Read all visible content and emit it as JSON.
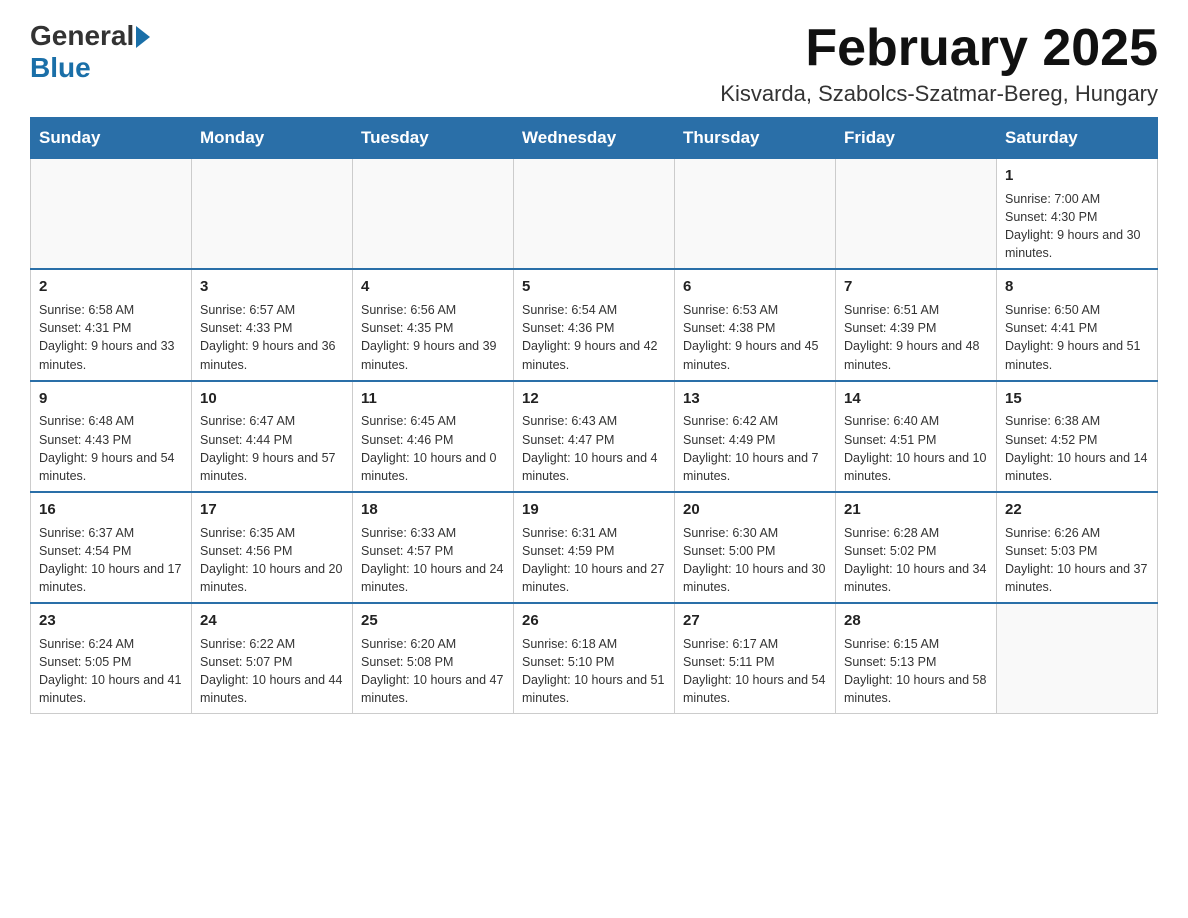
{
  "header": {
    "logo_general": "General",
    "logo_blue": "Blue",
    "month_title": "February 2025",
    "location": "Kisvarda, Szabolcs-Szatmar-Bereg, Hungary"
  },
  "days_of_week": [
    "Sunday",
    "Monday",
    "Tuesday",
    "Wednesday",
    "Thursday",
    "Friday",
    "Saturday"
  ],
  "weeks": [
    {
      "cells": [
        {
          "day": "",
          "info": ""
        },
        {
          "day": "",
          "info": ""
        },
        {
          "day": "",
          "info": ""
        },
        {
          "day": "",
          "info": ""
        },
        {
          "day": "",
          "info": ""
        },
        {
          "day": "",
          "info": ""
        },
        {
          "day": "1",
          "info": "Sunrise: 7:00 AM\nSunset: 4:30 PM\nDaylight: 9 hours and 30 minutes."
        }
      ]
    },
    {
      "cells": [
        {
          "day": "2",
          "info": "Sunrise: 6:58 AM\nSunset: 4:31 PM\nDaylight: 9 hours and 33 minutes."
        },
        {
          "day": "3",
          "info": "Sunrise: 6:57 AM\nSunset: 4:33 PM\nDaylight: 9 hours and 36 minutes."
        },
        {
          "day": "4",
          "info": "Sunrise: 6:56 AM\nSunset: 4:35 PM\nDaylight: 9 hours and 39 minutes."
        },
        {
          "day": "5",
          "info": "Sunrise: 6:54 AM\nSunset: 4:36 PM\nDaylight: 9 hours and 42 minutes."
        },
        {
          "day": "6",
          "info": "Sunrise: 6:53 AM\nSunset: 4:38 PM\nDaylight: 9 hours and 45 minutes."
        },
        {
          "day": "7",
          "info": "Sunrise: 6:51 AM\nSunset: 4:39 PM\nDaylight: 9 hours and 48 minutes."
        },
        {
          "day": "8",
          "info": "Sunrise: 6:50 AM\nSunset: 4:41 PM\nDaylight: 9 hours and 51 minutes."
        }
      ]
    },
    {
      "cells": [
        {
          "day": "9",
          "info": "Sunrise: 6:48 AM\nSunset: 4:43 PM\nDaylight: 9 hours and 54 minutes."
        },
        {
          "day": "10",
          "info": "Sunrise: 6:47 AM\nSunset: 4:44 PM\nDaylight: 9 hours and 57 minutes."
        },
        {
          "day": "11",
          "info": "Sunrise: 6:45 AM\nSunset: 4:46 PM\nDaylight: 10 hours and 0 minutes."
        },
        {
          "day": "12",
          "info": "Sunrise: 6:43 AM\nSunset: 4:47 PM\nDaylight: 10 hours and 4 minutes."
        },
        {
          "day": "13",
          "info": "Sunrise: 6:42 AM\nSunset: 4:49 PM\nDaylight: 10 hours and 7 minutes."
        },
        {
          "day": "14",
          "info": "Sunrise: 6:40 AM\nSunset: 4:51 PM\nDaylight: 10 hours and 10 minutes."
        },
        {
          "day": "15",
          "info": "Sunrise: 6:38 AM\nSunset: 4:52 PM\nDaylight: 10 hours and 14 minutes."
        }
      ]
    },
    {
      "cells": [
        {
          "day": "16",
          "info": "Sunrise: 6:37 AM\nSunset: 4:54 PM\nDaylight: 10 hours and 17 minutes."
        },
        {
          "day": "17",
          "info": "Sunrise: 6:35 AM\nSunset: 4:56 PM\nDaylight: 10 hours and 20 minutes."
        },
        {
          "day": "18",
          "info": "Sunrise: 6:33 AM\nSunset: 4:57 PM\nDaylight: 10 hours and 24 minutes."
        },
        {
          "day": "19",
          "info": "Sunrise: 6:31 AM\nSunset: 4:59 PM\nDaylight: 10 hours and 27 minutes."
        },
        {
          "day": "20",
          "info": "Sunrise: 6:30 AM\nSunset: 5:00 PM\nDaylight: 10 hours and 30 minutes."
        },
        {
          "day": "21",
          "info": "Sunrise: 6:28 AM\nSunset: 5:02 PM\nDaylight: 10 hours and 34 minutes."
        },
        {
          "day": "22",
          "info": "Sunrise: 6:26 AM\nSunset: 5:03 PM\nDaylight: 10 hours and 37 minutes."
        }
      ]
    },
    {
      "cells": [
        {
          "day": "23",
          "info": "Sunrise: 6:24 AM\nSunset: 5:05 PM\nDaylight: 10 hours and 41 minutes."
        },
        {
          "day": "24",
          "info": "Sunrise: 6:22 AM\nSunset: 5:07 PM\nDaylight: 10 hours and 44 minutes."
        },
        {
          "day": "25",
          "info": "Sunrise: 6:20 AM\nSunset: 5:08 PM\nDaylight: 10 hours and 47 minutes."
        },
        {
          "day": "26",
          "info": "Sunrise: 6:18 AM\nSunset: 5:10 PM\nDaylight: 10 hours and 51 minutes."
        },
        {
          "day": "27",
          "info": "Sunrise: 6:17 AM\nSunset: 5:11 PM\nDaylight: 10 hours and 54 minutes."
        },
        {
          "day": "28",
          "info": "Sunrise: 6:15 AM\nSunset: 5:13 PM\nDaylight: 10 hours and 58 minutes."
        },
        {
          "day": "",
          "info": ""
        }
      ]
    }
  ]
}
